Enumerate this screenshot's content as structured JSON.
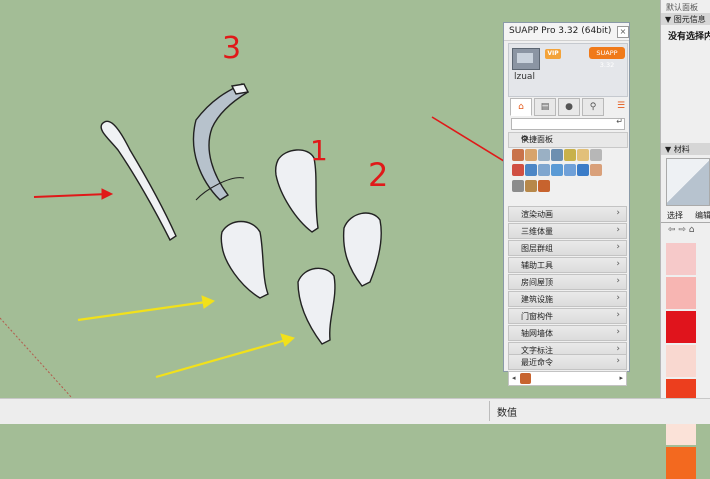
{
  "viewport": {
    "annotation_numbers": [
      "3",
      "1",
      "2"
    ]
  },
  "suapp": {
    "title": "SUAPP Pro 3.32 (64bit)",
    "close": "×",
    "username": "lzual",
    "vip_badge": "VIP",
    "version_badge": "SUAPP 3.32",
    "search_go": "↵",
    "quick_panel": "快捷面板",
    "menu": [
      "渲染动画",
      "三维体量",
      "图层群组",
      "辅助工具",
      "房间屋顶",
      "建筑设施",
      "门窗构件",
      "轴网墙体",
      "文字标注"
    ],
    "recent_label": "最近命令",
    "chevron": "›",
    "recent_left": "◂",
    "recent_right": "▸"
  },
  "tray": {
    "title": "默认面板",
    "entity_info": "▼ 图元信息",
    "nothing_selected": "没有选择内",
    "materials": "▼ 材料",
    "tab_select": "选择",
    "tab_edit": "编辑",
    "nav": "⇦ ⇨ ⌂",
    "colors": [
      "#f6c9c9",
      "#f7b5b2",
      "#e0141c",
      "#f9d8d0",
      "#ec3e1e",
      "#fbe2d8",
      "#f3691f"
    ]
  },
  "statusbar": {
    "label": "数值"
  }
}
